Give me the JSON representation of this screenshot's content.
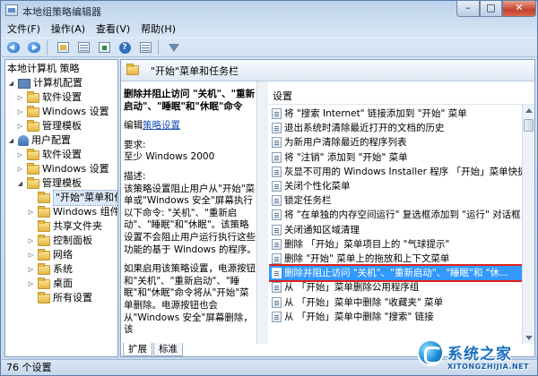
{
  "window": {
    "title": "本地组策略编辑器",
    "controls": {
      "minimize": "–",
      "maximize": "□",
      "close": "✕"
    }
  },
  "menu": [
    "文件(F)",
    "操作(A)",
    "查看(V)",
    "帮助(H)"
  ],
  "toolbar": {
    "icons": [
      "back-arrow-icon",
      "forward-arrow-icon",
      "up-folder-icon",
      "show-hide-tree-icon",
      "export-list-icon",
      "help-icon",
      "properties-icon",
      "filter-icon"
    ],
    "help_glyph": "?"
  },
  "tree": {
    "items": [
      {
        "label": "本地计算机 策略",
        "icon": "policy-icon"
      },
      {
        "label": "计算机配置",
        "icon": "computer-icon",
        "toggle": "◢"
      },
      {
        "label": "软件设置",
        "icon": "folder-icon",
        "toggle": "▷"
      },
      {
        "label": "Windows 设置",
        "icon": "folder-icon",
        "toggle": "▷"
      },
      {
        "label": "管理模板",
        "icon": "folder-icon",
        "toggle": "▷"
      },
      {
        "label": "用户配置",
        "icon": "user-icon",
        "toggle": "◢"
      },
      {
        "label": "软件设置",
        "icon": "folder-icon",
        "toggle": "▷"
      },
      {
        "label": "Windows 设置",
        "icon": "folder-icon",
        "toggle": "▷"
      },
      {
        "label": "管理模板",
        "icon": "folder-icon",
        "toggle": "◢"
      },
      {
        "label": "\"开始\"菜单和任",
        "icon": "folder-icon",
        "toggle": ""
      },
      {
        "label": "Windows 组件",
        "icon": "folder-icon",
        "toggle": "▷"
      },
      {
        "label": "共享文件夹",
        "icon": "folder-icon",
        "toggle": ""
      },
      {
        "label": "控制面板",
        "icon": "folder-icon",
        "toggle": "▷"
      },
      {
        "label": "网络",
        "icon": "folder-icon",
        "toggle": "▷"
      },
      {
        "label": "系统",
        "icon": "folder-icon",
        "toggle": "▷"
      },
      {
        "label": "桌面",
        "icon": "folder-icon",
        "toggle": "▷"
      },
      {
        "label": "所有设置",
        "icon": "folder-icon",
        "toggle": ""
      }
    ]
  },
  "content": {
    "header_title": "\"开始\"菜单和任务栏",
    "description": {
      "title": "删除并阻止访问 \"关机\"、\"重新启动\"、\"睡眠\"和\"休眠\"命令",
      "edit_prefix": "编辑",
      "edit_link": "策略设置",
      "requirements_label": "要求:",
      "requirements_value": "至少 Windows 2000",
      "desc_label": "描述:",
      "desc_text": "该策略设置阻止用户从\"开始\"菜单或\"Windows 安全\"屏幕执行以下命令: \"关机\"、\"重新启动\"、\"睡眠\"和\"休眠\"。该策略设置不会阻止用户运行执行这些功能的基于 Windows 的程序。",
      "extra_text": "如果启用该策略设置，电源按钮和\"关机\"、\"重新启动\"、\"睡眠\"和\"休眠\"命令将从\"开始\"菜单删除。电源按钮也会从\"Windows 安全\"屏幕删除，该"
    },
    "list_header": "设置",
    "settings": [
      "将 \"搜索 Internet\" 链接添加到 \"开始\" 菜单",
      "退出系统时清除最近打开的文档的历史",
      "为新用户清除最近的程序列表",
      "将 \"注销\" 添加到 \"开始\" 菜单",
      "灰显不可用的 Windows Installer 程序 「开始」菜单快捷方...",
      "关闭个性化菜单",
      "锁定任务栏",
      "将 \"在单独的内存空间运行\" 复选框添加到 \"运行\" 对话框",
      "关闭通知区域清理",
      "删除 「开始」菜单项目上的 \"气球提示\"",
      "删除 \"开始\" 菜单上的拖放和上下文菜单",
      "删除并阻止访问 \"关机\"、\"重新启动\"、\"睡眠\"和 \"休...",
      "从 「开始」菜单删除公用程序组",
      "从 「开始」菜单中删除 \"收藏夹\" 菜单",
      "从 「开始」菜单中删除 \"搜索\" 链接"
    ],
    "selected_index": 11,
    "tabs": [
      "扩展",
      "标准"
    ]
  },
  "status": {
    "text": "76 个设置"
  },
  "watermark": {
    "main": "系统之家",
    "sub": "XITONGZHIJIA.NET"
  }
}
